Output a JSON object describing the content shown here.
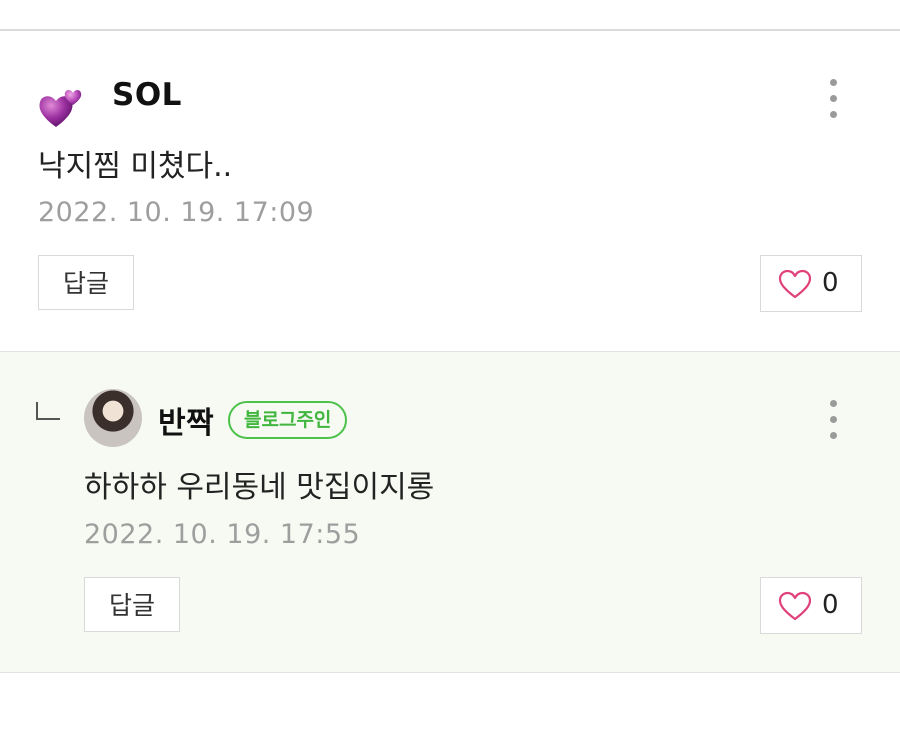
{
  "comments": [
    {
      "username": "SOL",
      "text": "낙지찜 미쳤다..",
      "date": "2022. 10. 19. 17:09",
      "reply_label": "답글",
      "like_count": "0"
    },
    {
      "username": "반짝",
      "badge": "블로그주인",
      "text": "하하하 우리동네 맛집이지롱",
      "date": "2022. 10. 19. 17:55",
      "reply_label": "답글",
      "like_count": "0"
    }
  ],
  "colors": {
    "badge_green": "#41b63f",
    "reply_background": "#f7faf2",
    "heart_pink": "#e0417a",
    "meta_gray": "#9e9e9e"
  },
  "icons": {
    "heart_avatar": "purple-hearts-icon",
    "more": "vertical-ellipsis-icon",
    "like": "heart-outline-icon",
    "reply_indicator": "reply-corner-icon"
  }
}
